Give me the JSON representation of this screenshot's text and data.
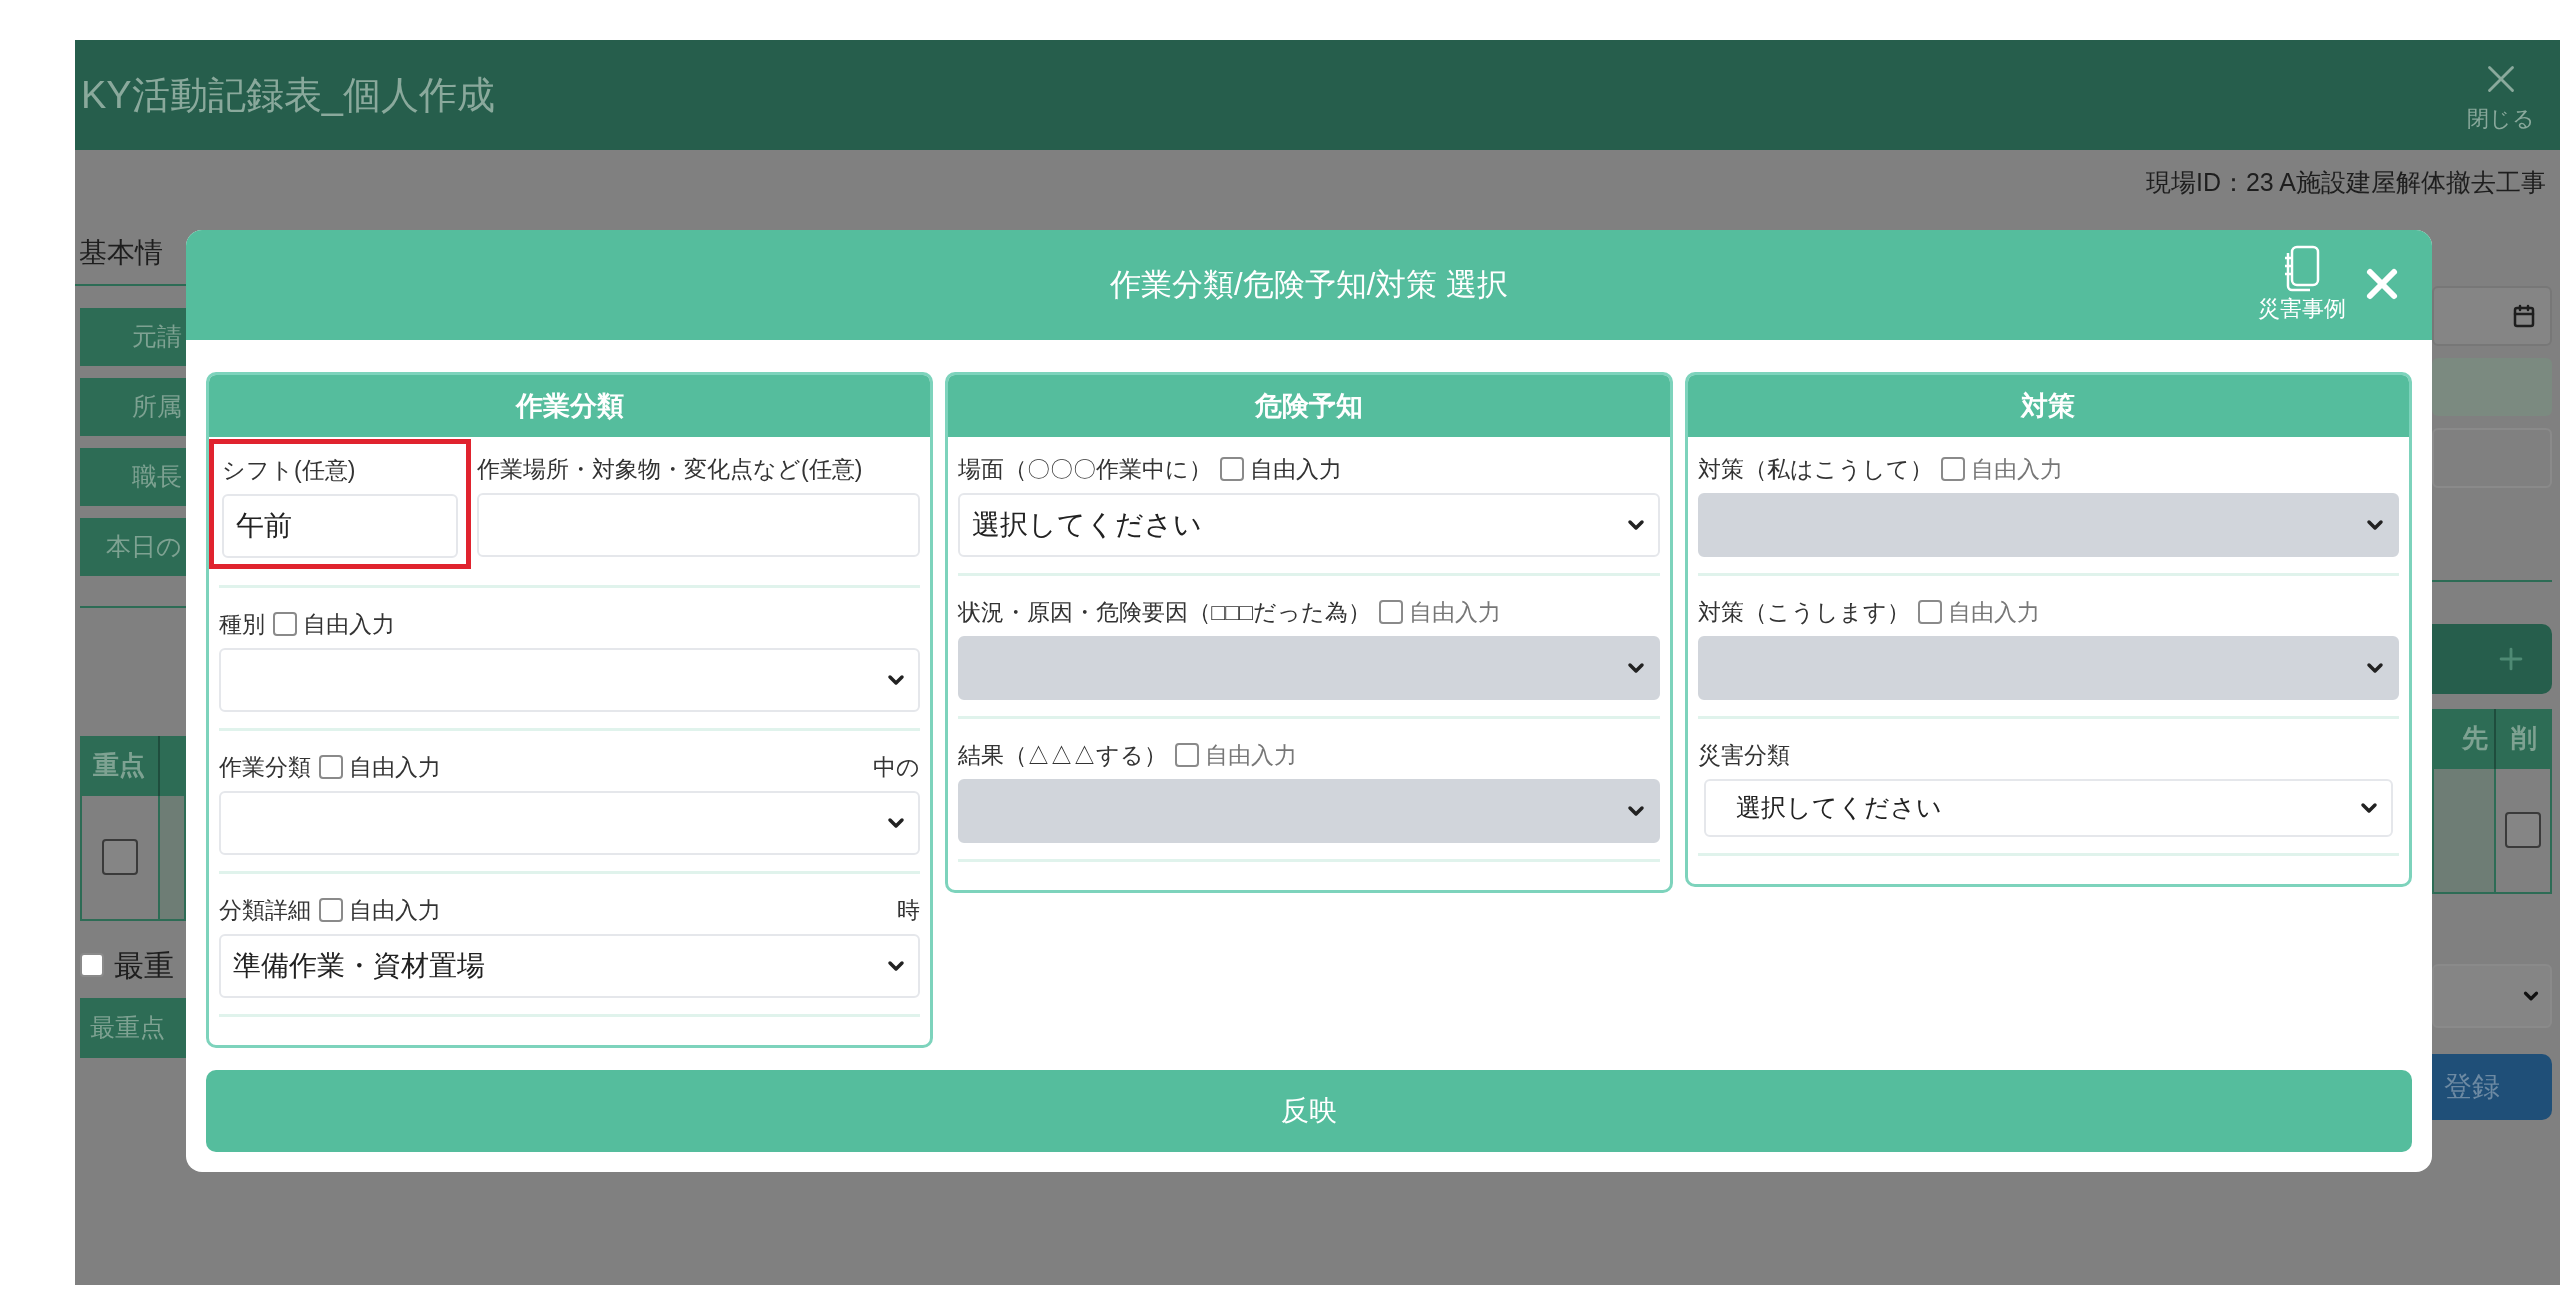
{
  "page": {
    "title": "KY活動記録表_個人作成",
    "close_label": "閉じる",
    "site_id": "現場ID：23 A施設建屋解体撤去工事",
    "section_heading": "基本情",
    "left_labels": [
      "元請",
      "所属",
      "職長",
      "本日の"
    ],
    "table_left": {
      "headers": [
        "重点"
      ],
      "row_checked": false
    },
    "table_right": {
      "headers": [
        "先",
        "削"
      ],
      "row_checked": false
    },
    "top_priority": {
      "label": "最重",
      "checked": false
    },
    "top_priority_bar": "最重点",
    "submit": "登録"
  },
  "modal": {
    "title": "作業分類/危険予知/対策 選択",
    "examples_label": "災害事例",
    "apply_button": "反映",
    "columns": [
      {
        "title": "作業分類",
        "rows": [
          [
            {
              "label": "シフト(任意)",
              "kind": "input",
              "value": "午前",
              "disabled": false,
              "highlighted": true
            },
            {
              "label": "作業場所・対象物・変化点など(任意)",
              "kind": "input",
              "disabled": false,
              "highlighted": false
            }
          ],
          [
            {
              "label": "種別",
              "free_input": {
                "label": "自由入力",
                "checked": false
              },
              "kind": "select",
              "disabled": false,
              "highlighted": false
            }
          ],
          [
            {
              "label": "作業分類",
              "free_input": {
                "label": "自由入力",
                "checked": false
              },
              "note": "中の",
              "kind": "select",
              "disabled": false,
              "highlighted": false
            }
          ],
          [
            {
              "label": "分類詳細",
              "free_input": {
                "label": "自由入力",
                "checked": false
              },
              "note": "時",
              "kind": "select",
              "value": "準備作業・資材置場",
              "disabled": false,
              "highlighted": false
            }
          ]
        ]
      },
      {
        "title": "危険予知",
        "rows": [
          [
            {
              "label": "場面（〇〇〇作業中に）",
              "free_input": {
                "label": "自由入力",
                "checked": false
              },
              "kind": "select",
              "value": "選択してください",
              "disabled": false,
              "highlighted": false
            }
          ],
          [
            {
              "label": "状況・原因・危険要因（□□□だった為）",
              "free_input": {
                "label": "自由入力",
                "checked": false
              },
              "kind": "select",
              "disabled": true,
              "highlighted": false
            }
          ],
          [
            {
              "label": "結果（△△△する）",
              "free_input": {
                "label": "自由入力",
                "checked": false
              },
              "kind": "select",
              "disabled": true,
              "highlighted": false
            }
          ]
        ]
      },
      {
        "title": "対策",
        "rows": [
          [
            {
              "label": "対策（私はこうして）",
              "free_input": {
                "label": "自由入力",
                "checked": false
              },
              "kind": "select",
              "disabled": true,
              "highlighted": false
            }
          ],
          [
            {
              "label": "対策（こうします）",
              "free_input": {
                "label": "自由入力",
                "checked": false
              },
              "kind": "select",
              "disabled": true,
              "highlighted": false
            }
          ],
          [
            {
              "label": "災害分類",
              "kind": "select_inset",
              "value": "選択してください",
              "disabled": false,
              "highlighted": false
            }
          ]
        ]
      }
    ]
  }
}
